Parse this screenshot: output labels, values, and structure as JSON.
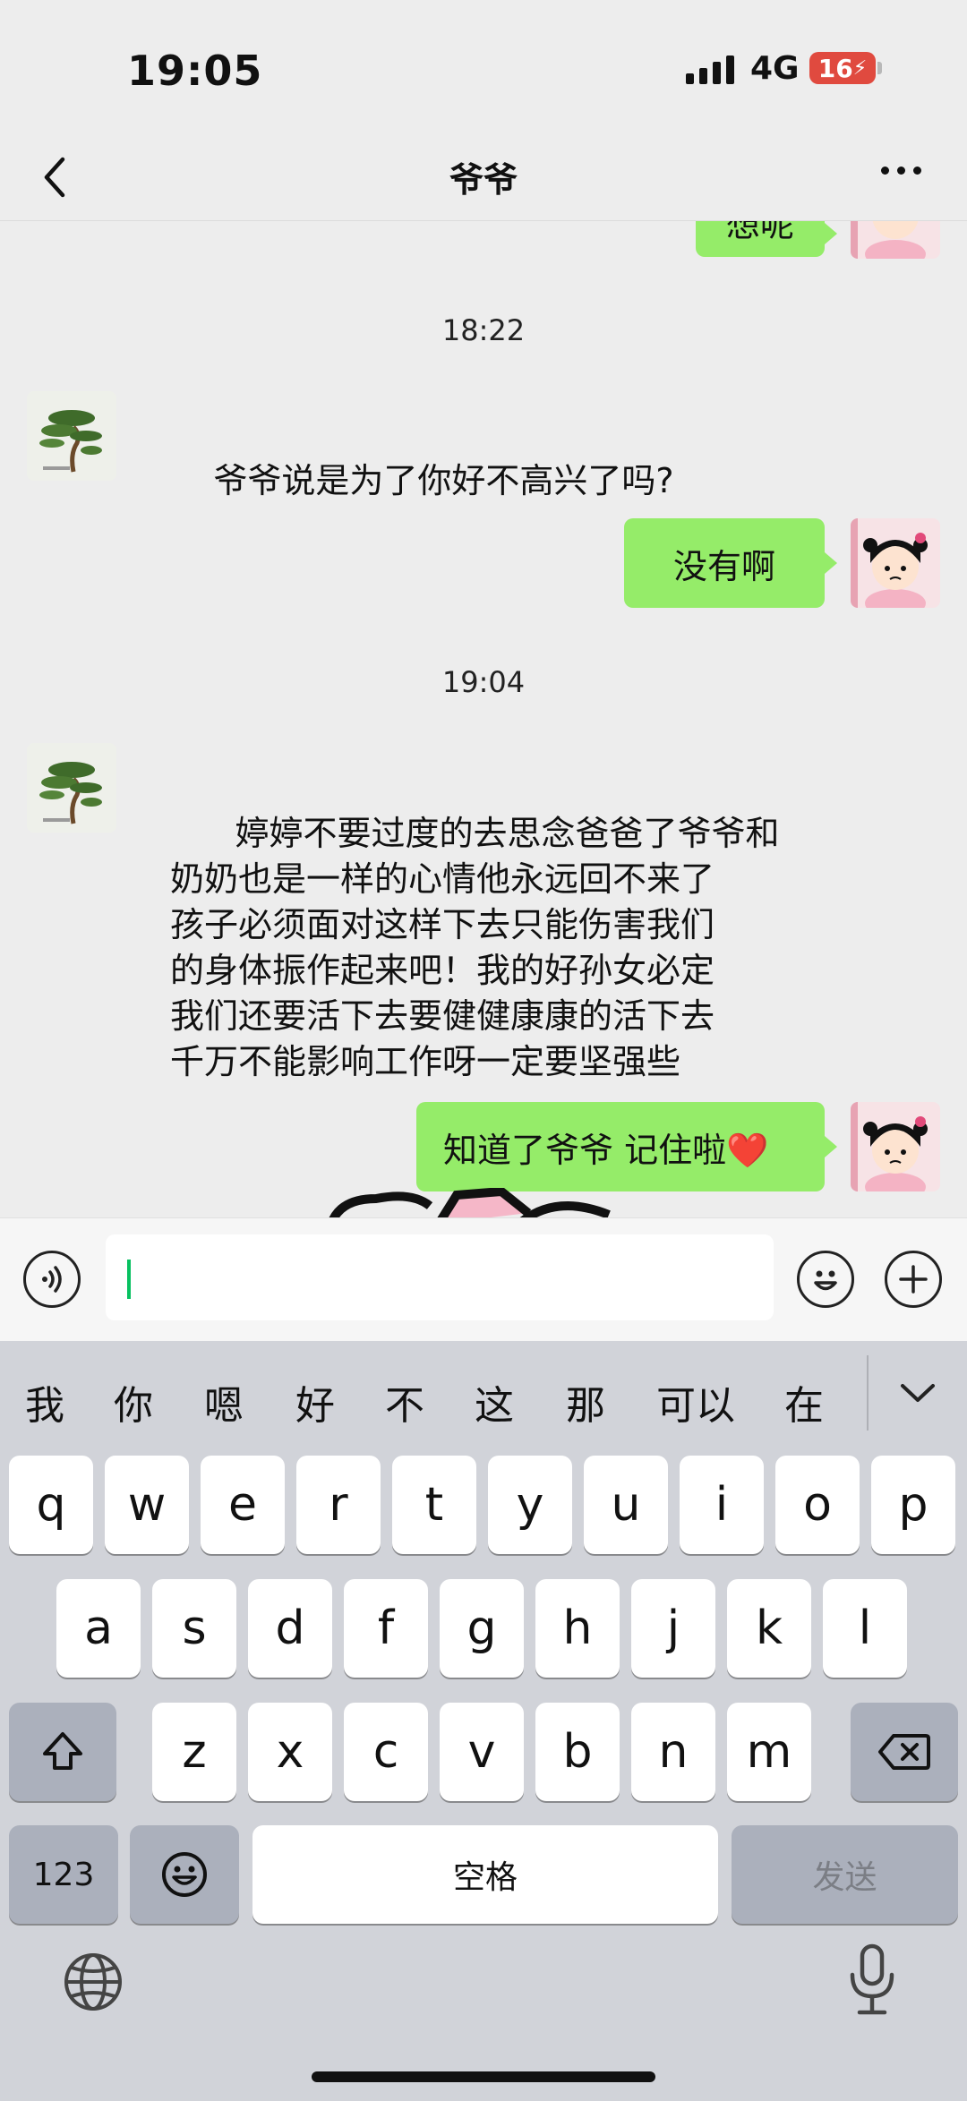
{
  "status": {
    "time": "19:05",
    "network": "4G",
    "battery": "16"
  },
  "nav": {
    "title": "爷爷"
  },
  "chat": {
    "partial_message": "想呢",
    "messages": [
      {
        "timestamp": "18:22"
      },
      {
        "from": "contact",
        "text": "爷爷说是为了你好不高兴了吗?"
      },
      {
        "from": "me",
        "text": "没有啊"
      },
      {
        "timestamp": "19:04"
      },
      {
        "from": "contact",
        "text": "  婷婷不要过度的去思念爸爸了爷爷和\n奶奶也是一样的心情他永远回不来了\n孩子必须面对这样下去只能伤害我们\n的身体振作起来吧！我的好孙女必定\n我们还要活下去要健健康康的活下去\n千万不能影响工作呀一定要坚强些"
      },
      {
        "from": "me",
        "text": "知道了爷爷 记住啦❤️"
      }
    ]
  },
  "input": {
    "value": ""
  },
  "keyboard": {
    "candidates": [
      "我",
      "你",
      "嗯",
      "好",
      "不",
      "这",
      "那",
      "可以",
      "在"
    ],
    "row1": [
      "q",
      "w",
      "e",
      "r",
      "t",
      "y",
      "u",
      "i",
      "o",
      "p"
    ],
    "row2": [
      "a",
      "s",
      "d",
      "f",
      "g",
      "h",
      "j",
      "k",
      "l"
    ],
    "row3": [
      "z",
      "x",
      "c",
      "v",
      "b",
      "n",
      "m"
    ],
    "numbers_label": "123",
    "space_label": "空格",
    "send_label": "发送"
  },
  "colors": {
    "bubble_out": "#95ec69",
    "accent": "#07c160",
    "battery": "#e04a3f"
  }
}
